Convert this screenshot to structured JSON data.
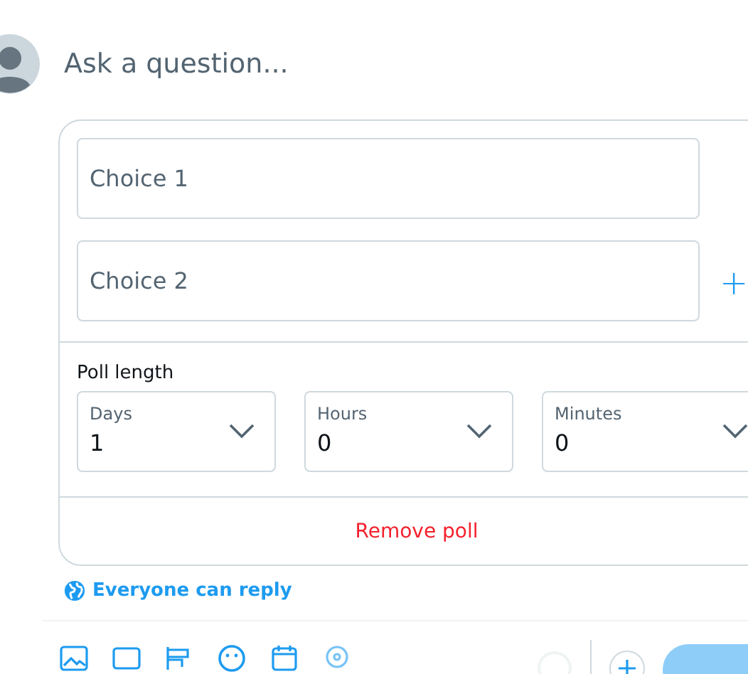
{
  "composer": {
    "placeholder": "Ask a question..."
  },
  "poll": {
    "choices": [
      {
        "placeholder": "Choice 1"
      },
      {
        "placeholder": "Choice 2"
      }
    ],
    "add_choice": "+",
    "length_label": "Poll length",
    "length_fields": [
      {
        "label": "Days",
        "value": "1"
      },
      {
        "label": "Hours",
        "value": "0"
      },
      {
        "label": "Minutes",
        "value": "0"
      }
    ],
    "remove": "Remove poll"
  },
  "reply_setting": "Everyone can reply"
}
